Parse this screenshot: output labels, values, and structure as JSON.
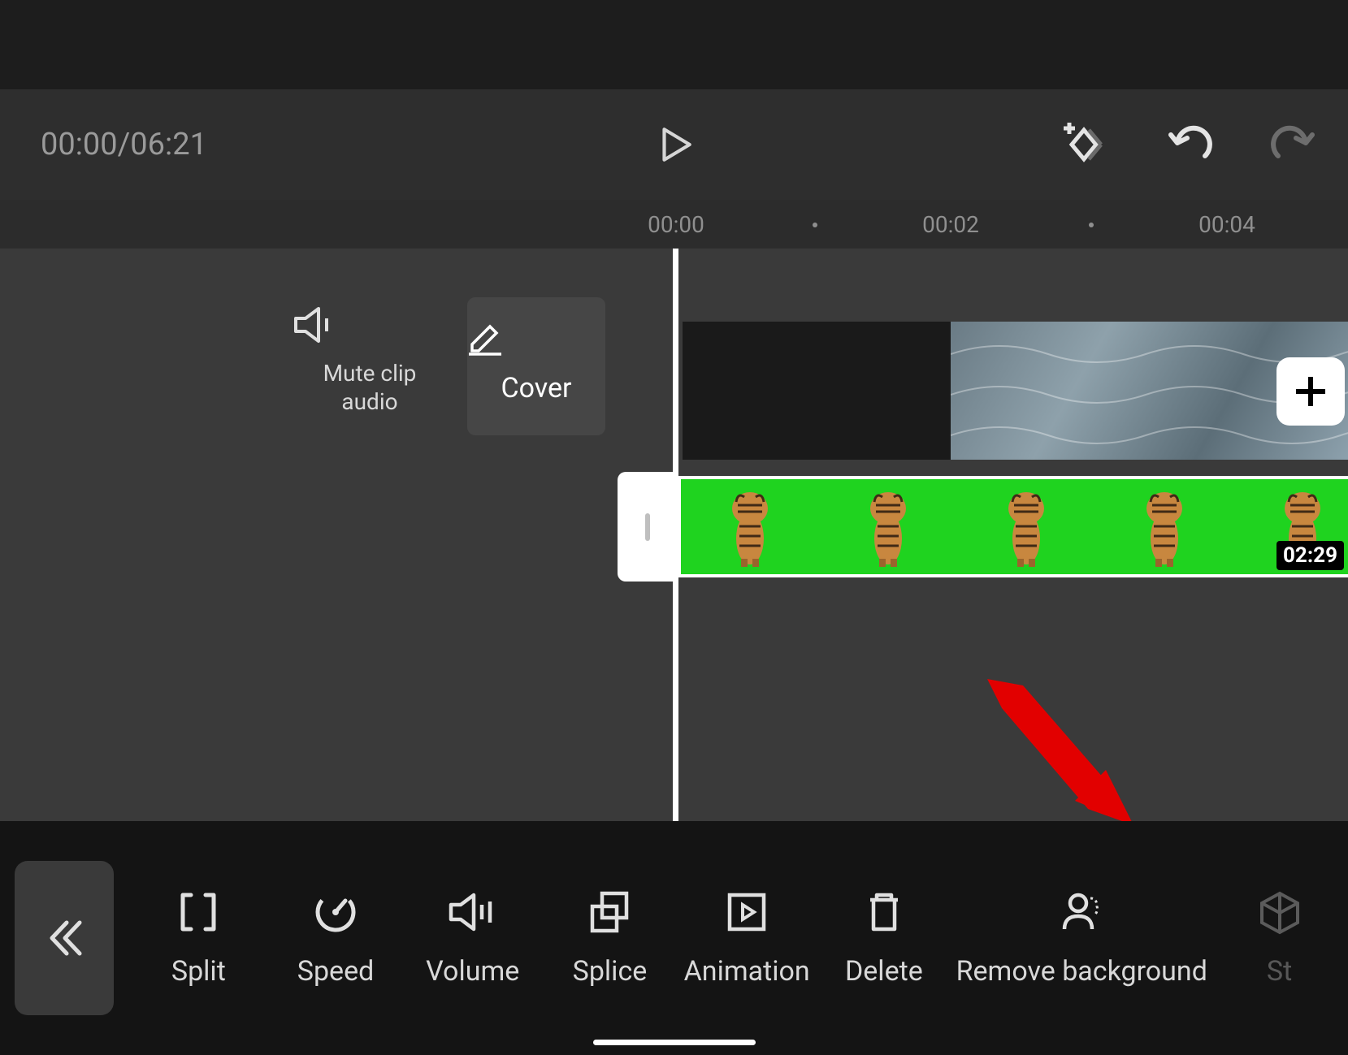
{
  "transport": {
    "time_current": "00:00",
    "time_total": "06:21",
    "timecode": "00:00/06:21"
  },
  "ruler": {
    "marks": [
      "00:00",
      "00:02",
      "00:04"
    ]
  },
  "timeline_controls": {
    "mute_label": "Mute clip audio",
    "cover_label": "Cover",
    "clip_duration": "02:29"
  },
  "toolbar": {
    "items": [
      {
        "id": "split",
        "label": "Split"
      },
      {
        "id": "speed",
        "label": "Speed"
      },
      {
        "id": "volume",
        "label": "Volume"
      },
      {
        "id": "splice",
        "label": "Splice"
      },
      {
        "id": "animation",
        "label": "Animation"
      },
      {
        "id": "delete",
        "label": "Delete"
      },
      {
        "id": "remove-bg",
        "label": "Remove background"
      },
      {
        "id": "style",
        "label": "St"
      }
    ]
  },
  "annotation": {
    "type": "arrow",
    "target": "remove-background-button",
    "color": "#e20000"
  }
}
